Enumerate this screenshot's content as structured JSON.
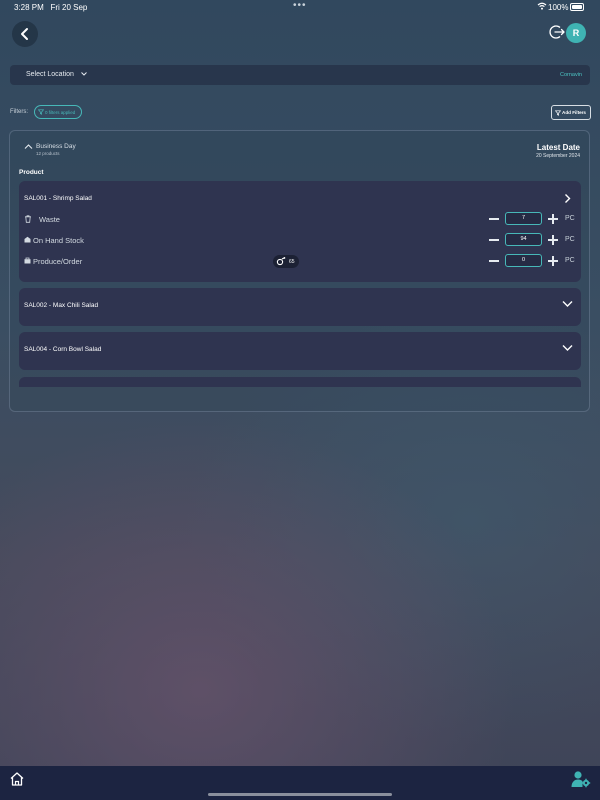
{
  "status_bar": {
    "time": "3:28 PM",
    "date": "Fri 20 Sep",
    "battery": "100%"
  },
  "header": {
    "avatar_initial": "R",
    "back_icon": "chevron-left-icon",
    "logout_icon": "logout-icon"
  },
  "location": {
    "label": "Select Location",
    "value": "Cornavin"
  },
  "filters": {
    "label": "Filters:",
    "pill": "0 filters applied",
    "add_button": "Add Filters"
  },
  "business_day": {
    "title": "Business Day",
    "subtitle": "12 products",
    "latest_label": "Latest Date",
    "latest_date": "20 September 2024"
  },
  "product_header": "Product",
  "products": [
    {
      "name": "SAL001 - Shrimp Salad",
      "rows": [
        {
          "label": "Waste",
          "value": "7",
          "unit": "PC",
          "icon": "trash-icon"
        },
        {
          "label": "On Hand Stock",
          "value": "94",
          "unit": "PC",
          "icon": "stock-icon"
        },
        {
          "label": "Produce/Order",
          "value": "0",
          "unit": "PC",
          "icon": "order-icon"
        }
      ],
      "badge": "65"
    },
    {
      "name": "SAL002 - Max Chili Salad"
    },
    {
      "name": "SAL004 - Corn Bowl Salad"
    }
  ],
  "colors": {
    "accent": "#47b8b8",
    "card": "#2f3450",
    "bottom_bar": "#1c2441"
  }
}
